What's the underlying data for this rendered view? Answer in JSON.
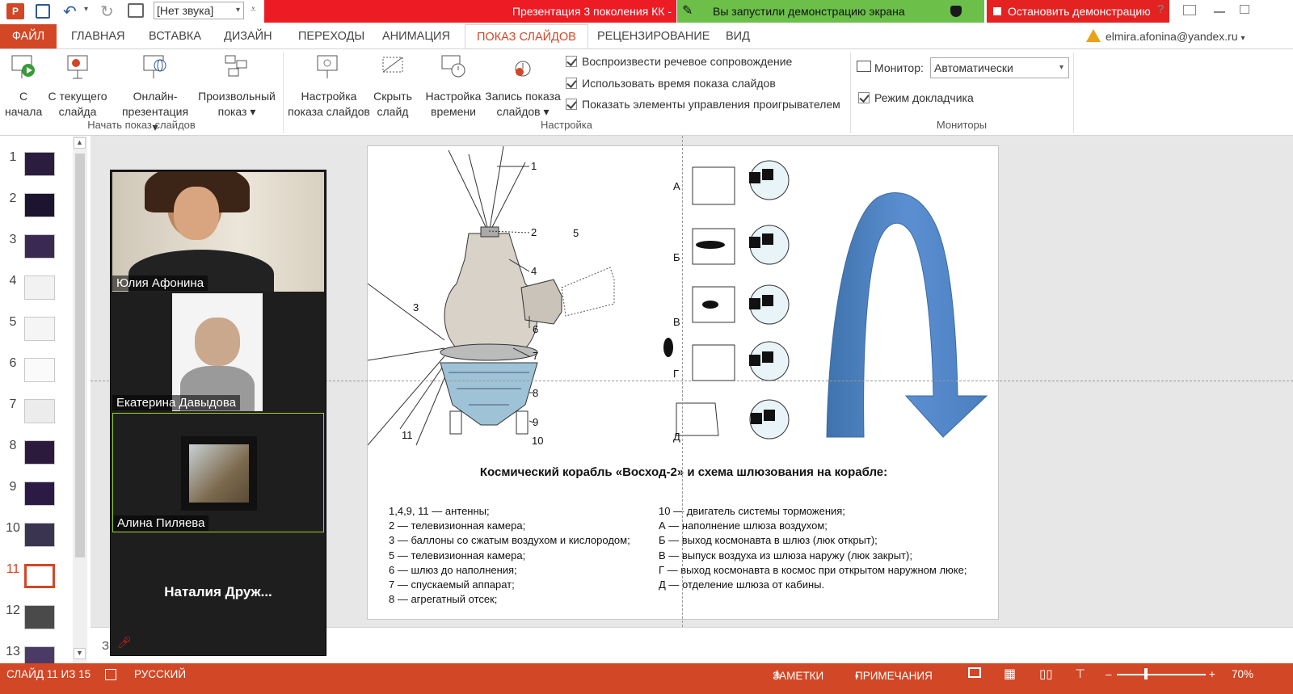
{
  "titlebar": {
    "sound_select": "[Нет звука]",
    "doc_title": "Презентация 3 поколения КК -",
    "share_notice": "Вы запустили демонстрацию экрана",
    "stop_share": "Остановить демонстрацию",
    "help": "?"
  },
  "tabs": {
    "file": "ФАЙЛ",
    "home": "ГЛАВНАЯ",
    "insert": "ВСТАВКА",
    "design": "ДИЗАЙН",
    "transitions": "ПЕРЕХОДЫ",
    "animation": "АНИМАЦИЯ",
    "slideshow": "ПОКАЗ СЛАЙДОВ",
    "review": "РЕЦЕНЗИРОВАНИЕ",
    "view": "ВИД",
    "user": "elmira.afonina@yandex.ru"
  },
  "ribbon": {
    "from_start": [
      "С",
      "начала"
    ],
    "from_current": [
      "С текущего",
      "слайда"
    ],
    "online": [
      "Онлайн-",
      "презентация ▾"
    ],
    "custom": [
      "Произвольный",
      "показ ▾"
    ],
    "group_start": "Начать показ слайдов",
    "setup": [
      "Настройка",
      "показа слайдов"
    ],
    "hide": [
      "Скрыть",
      "слайд"
    ],
    "rehearse": [
      "Настройка",
      "времени"
    ],
    "record": [
      "Запись показа",
      "слайдов ▾"
    ],
    "chk_narration": "Воспроизвести речевое сопровождение",
    "chk_timings": "Использовать время показа слайдов",
    "chk_controls": "Показать элементы управления проигрывателем",
    "group_setup": "Настройка",
    "monitor_label": "Монитор:",
    "monitor_value": "Автоматически",
    "presenter_view": "Режим докладчика",
    "group_monitors": "Мониторы"
  },
  "thumbnails": [
    "1",
    "2",
    "3",
    "4",
    "5",
    "6",
    "7",
    "8",
    "9",
    "10",
    "11",
    "12",
    "13"
  ],
  "selected_slide": "11",
  "zoom": {
    "p1": "Юлия Афонина",
    "p2": "Екатерина Давыдова",
    "p3": "Алина Пиляева",
    "p4": "Наталия  Друж..."
  },
  "slide": {
    "caption": "Космический корабль «Восход-2» и схема шлюзования на корабле:",
    "diagram_numbers": [
      "1",
      "2",
      "4",
      "5",
      "3",
      "6",
      "7",
      "8",
      "9",
      "10",
      "11"
    ],
    "stage_letters": [
      "А",
      "Б",
      "В",
      "Г",
      "Д"
    ],
    "legend_left": [
      "1,4,9, 11 — антенны;",
      "2 — телевизионная камера;",
      "3 — баллоны со сжатым воздухом и кислородом;",
      "5 — телевизионная камера;",
      "6 — шлюз до наполнения;",
      "7 — спускаемый аппарат;",
      "8 — агрегатный отсек;"
    ],
    "legend_right": [
      "10 — двигатель системы торможения;",
      "А — наполнение шлюза воздухом;",
      "Б — выход космонавта в шлюз (люк открыт);",
      "В — выпуск воздуха из шлюза наружу (люк закрыт);",
      "Г — выход космонавта в космос при открытом наружном люке;",
      "Д — отделение шлюза от кабины."
    ]
  },
  "notes_placeholder": "З",
  "status": {
    "slide_info": "СЛАЙД 11 ИЗ 15",
    "language": "РУССКИЙ",
    "notes": "ЗАМЕТКИ",
    "comments": "ПРИМЕЧАНИЯ",
    "zoom": "70%"
  },
  "colors": {
    "accent": "#d24726",
    "share_green": "#6cc04a",
    "share_red": "#ed1c24",
    "arrow_blue": "#5b8fd1"
  }
}
